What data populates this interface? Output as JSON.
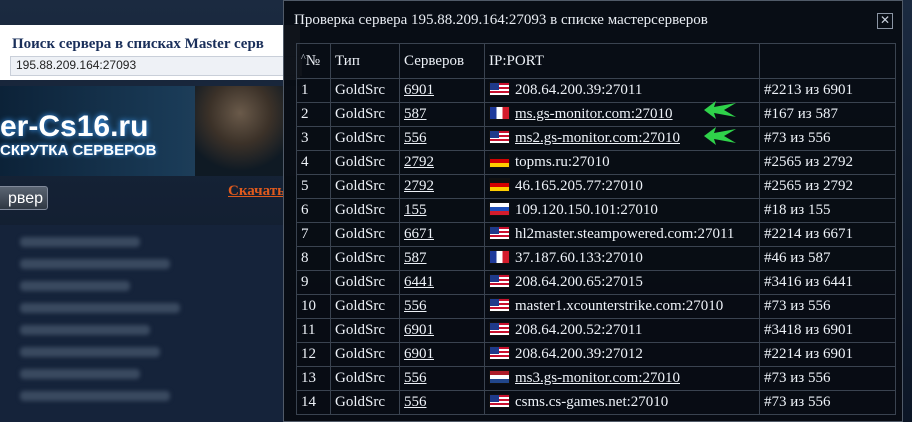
{
  "background": {
    "search_title": "Поиск сервера в списках Master серв",
    "search_value": "195.88.209.164:27093",
    "logo_text": "er-Cs16.ru",
    "logo_subtitle": "СКРУТКА СЕРВЕРОВ",
    "download_link": "Скачать",
    "server_button": "рвер"
  },
  "dialog": {
    "title": "Проверка сервера 195.88.209.164:27093 в списке мастерсерверов",
    "close_label": "✕",
    "columns": {
      "num": "№",
      "type": "Тип",
      "servers": "Серверов",
      "ipport": "IP:PORT",
      "position": ""
    },
    "rows": [
      {
        "num": "1",
        "type": "GoldSrc",
        "servers": "6901",
        "flag": "us",
        "ipport": "208.64.200.39:27011",
        "link": false,
        "position": "#2213 из 6901"
      },
      {
        "num": "2",
        "type": "GoldSrc",
        "servers": "587",
        "flag": "fr",
        "ipport": "ms.gs-monitor.com:27010",
        "link": true,
        "position": "#167 из 587"
      },
      {
        "num": "3",
        "type": "GoldSrc",
        "servers": "556",
        "flag": "us",
        "ipport": "ms2.gs-monitor.com:27010",
        "link": true,
        "position": "#73 из 556"
      },
      {
        "num": "4",
        "type": "GoldSrc",
        "servers": "2792",
        "flag": "de",
        "ipport": "topms.ru:27010",
        "link": false,
        "position": "#2565 из 2792"
      },
      {
        "num": "5",
        "type": "GoldSrc",
        "servers": "2792",
        "flag": "de",
        "ipport": "46.165.205.77:27010",
        "link": false,
        "position": "#2565 из 2792"
      },
      {
        "num": "6",
        "type": "GoldSrc",
        "servers": "155",
        "flag": "ru",
        "ipport": "109.120.150.101:27010",
        "link": false,
        "position": "#18 из 155"
      },
      {
        "num": "7",
        "type": "GoldSrc",
        "servers": "6671",
        "flag": "us",
        "ipport": "hl2master.steampowered.com:27011",
        "link": false,
        "position": "#2214 из 6671"
      },
      {
        "num": "8",
        "type": "GoldSrc",
        "servers": "587",
        "flag": "fr",
        "ipport": "37.187.60.133:27010",
        "link": false,
        "position": "#46 из 587"
      },
      {
        "num": "9",
        "type": "GoldSrc",
        "servers": "6441",
        "flag": "us",
        "ipport": "208.64.200.65:27015",
        "link": false,
        "position": "#3416 из 6441"
      },
      {
        "num": "10",
        "type": "GoldSrc",
        "servers": "556",
        "flag": "us",
        "ipport": "master1.xcounterstrike.com:27010",
        "link": false,
        "position": "#73 из 556"
      },
      {
        "num": "11",
        "type": "GoldSrc",
        "servers": "6901",
        "flag": "us",
        "ipport": "208.64.200.52:27011",
        "link": false,
        "position": "#3418 из 6901"
      },
      {
        "num": "12",
        "type": "GoldSrc",
        "servers": "6901",
        "flag": "us",
        "ipport": "208.64.200.39:27012",
        "link": false,
        "position": "#2214 из 6901"
      },
      {
        "num": "13",
        "type": "GoldSrc",
        "servers": "556",
        "flag": "nl",
        "ipport": "ms3.gs-monitor.com:27010",
        "link": true,
        "position": "#73 из 556"
      },
      {
        "num": "14",
        "type": "GoldSrc",
        "servers": "556",
        "flag": "us",
        "ipport": "csms.cs-games.net:27010",
        "link": false,
        "position": "#73 из 556"
      }
    ]
  },
  "colors": {
    "highlight_arrow": "#2fd24a",
    "download_link": "#e05a1d"
  }
}
